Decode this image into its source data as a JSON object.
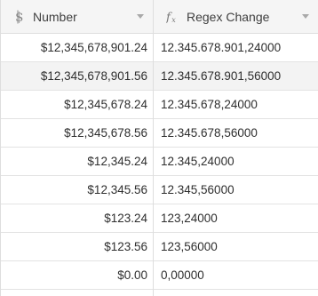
{
  "columns": {
    "number": {
      "label": "Number",
      "icon": "currency-icon"
    },
    "regex": {
      "label": "Regex Change",
      "icon": "formula-icon"
    }
  },
  "rows": [
    {
      "number": "$12,345,678,901.24",
      "regex": "12.345.678.901,24000"
    },
    {
      "number": "$12,345,678,901.56",
      "regex": "12.345.678.901,56000"
    },
    {
      "number": "$12,345,678.24",
      "regex": "12.345.678,24000"
    },
    {
      "number": "$12,345,678.56",
      "regex": "12.345.678,56000"
    },
    {
      "number": "$12,345.24",
      "regex": "12.345,24000"
    },
    {
      "number": "$12,345.56",
      "regex": "12.345,56000"
    },
    {
      "number": "$123.24",
      "regex": "123,24000"
    },
    {
      "number": "$123.56",
      "regex": "123,56000"
    },
    {
      "number": "$0.00",
      "regex": "0,00000"
    }
  ]
}
